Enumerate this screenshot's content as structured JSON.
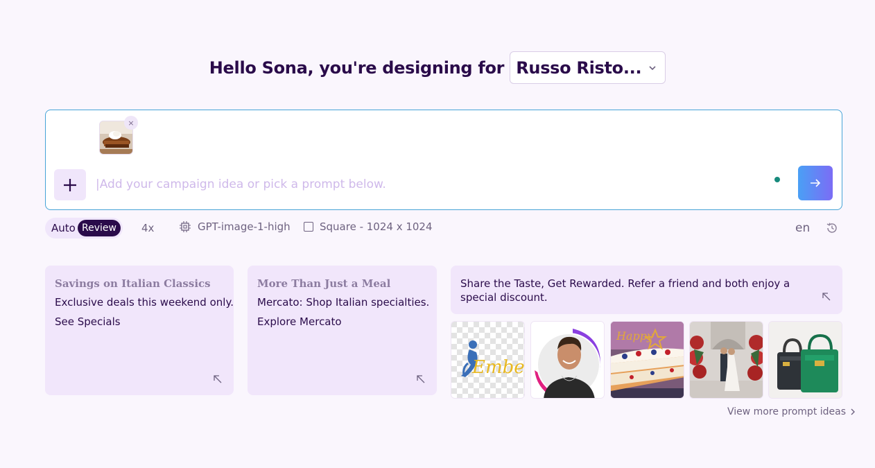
{
  "header": {
    "greeting": "Hello Sona, you're designing for",
    "brand": "Russo Risto..."
  },
  "prompt": {
    "placeholder": "|Add your campaign idea or pick a prompt below.",
    "remove_label": "×"
  },
  "toolbar": {
    "mode_auto": "Auto",
    "mode_review": "Review",
    "count": "4x",
    "model": "GPT-image-1-high",
    "size": "Square - 1024 x 1024",
    "language": "en"
  },
  "cards": [
    {
      "title": "Savings on Italian Classics",
      "line1": "Exclusive deals this weekend only.",
      "line2": "See Specials"
    },
    {
      "title": "More Than Just a Meal",
      "line1": "Mercato: Shop Italian specialties.",
      "line2": "Explore Mercato"
    },
    {
      "text": "Share the Taste, Get Rewarded. Refer a friend and both enjoy a special discount."
    }
  ],
  "gallery": {
    "logo_text": "Embee",
    "cake_text": "Happy"
  },
  "view_more": "View more prompt ideas",
  "colors": {
    "background": "#faf6fd",
    "primary_text": "#2a0b4a",
    "card_bg": "#f1e6fb",
    "input_border": "#45a3d7",
    "send_gradient_start": "#4aa0f5",
    "send_gradient_end": "#7b6cf5",
    "status_dot": "#178a7c"
  },
  "icons": [
    "chevron-down-icon",
    "close-icon",
    "plus-icon",
    "arrow-right-icon",
    "chip-icon",
    "checkbox-icon",
    "history-icon",
    "arrow-up-left-icon",
    "chevron-right-icon"
  ]
}
